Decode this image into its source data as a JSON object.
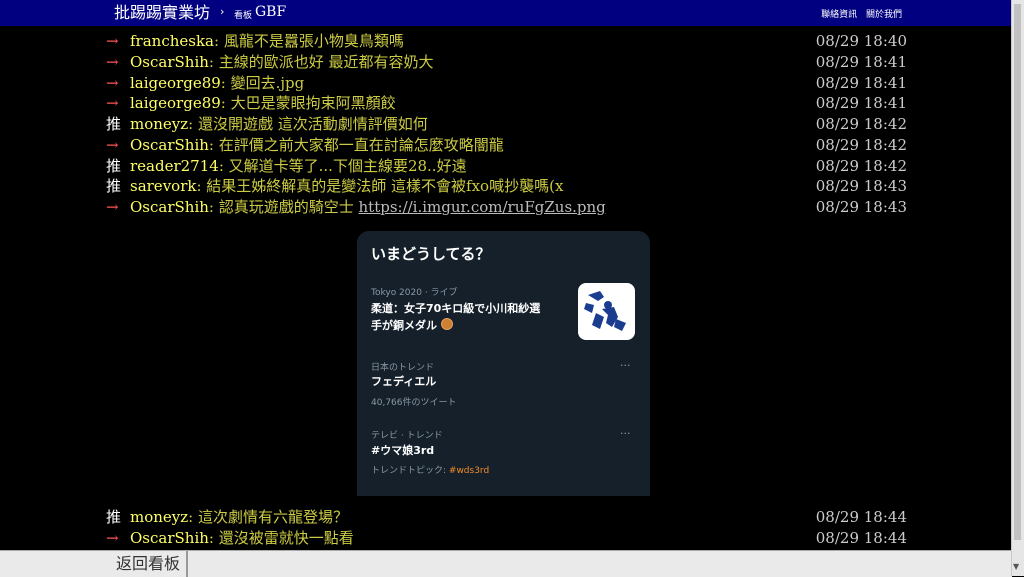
{
  "header": {
    "site_title": "批踢踢實業坊",
    "separator": "›",
    "board_label": "看板",
    "board_name": "GBF",
    "links": [
      "聯絡資訊",
      "關於我們"
    ]
  },
  "pushes_top": [
    {
      "tag": "→",
      "user": "francheska",
      "content": ": 風龍不是囂張小物臭鳥類嗎",
      "time": "08/29 18:40"
    },
    {
      "tag": "→",
      "user": "OscarShih",
      "content": ": 主線的歐派也好 最近都有容奶大",
      "time": "08/29 18:41"
    },
    {
      "tag": "→",
      "user": "laigeorge89",
      "content": ": 變回去.jpg",
      "time": "08/29 18:41"
    },
    {
      "tag": "→",
      "user": "laigeorge89",
      "content": ": 大巴是蒙眼拘束阿黑顏餃",
      "time": "08/29 18:41"
    },
    {
      "tag": "推",
      "user": "moneyz",
      "content": ": 還沒開遊戲 這次活動劇情評價如何",
      "time": "08/29 18:42"
    },
    {
      "tag": "→",
      "user": "OscarShih",
      "content": ": 在評價之前大家都一直在討論怎麼攻略闇龍",
      "time": "08/29 18:42"
    },
    {
      "tag": "推",
      "user": "reader2714",
      "content": ": 又解道卡等了...下個主線要28..好遠",
      "time": "08/29 18:42"
    },
    {
      "tag": "推",
      "user": "sarevork",
      "content": ": 結果王姊終解真的是變法師 這樣不會被fxo喊抄襲嗎(x",
      "time": "08/29 18:43"
    },
    {
      "tag": "→",
      "user": "OscarShih",
      "content": ": 認真玩遊戲的騎空士 ",
      "link": "https://i.imgur.com/ruFgZus.png",
      "time": "08/29 18:43"
    }
  ],
  "pushes_bottom": [
    {
      "tag": "推",
      "user": "moneyz",
      "content": ": 這次劇情有六龍登場？",
      "time": "08/29 18:44"
    },
    {
      "tag": "→",
      "user": "OscarShih",
      "content": ": 還沒被雷就快一點看",
      "time": "08/29 18:44"
    }
  ],
  "twitter_card": {
    "heading": "いまどうしてる？",
    "item1_meta": "Tokyo 2020 · ライブ",
    "item1_title_line1": "柔道：女子70キロ級で小川和紗選",
    "item1_title_line2": "手が銅メダル",
    "item2_meta": "日本のトレンド",
    "item2_title": "フェディエル",
    "item2_sub": "40,766件のツイート",
    "item3_meta": "テレビ · トレンド",
    "item3_title": "#ウマ娘3rd",
    "item3_sub_prefix": "トレンドトピック: ",
    "item3_sub_tag": "#wds3rd",
    "more": "···"
  },
  "footer": {
    "back_label": "返回看板"
  },
  "colors": {
    "header_bg": "#000080",
    "arrow_tag": "#ff5555",
    "user": "#ffff66",
    "content": "#cccc44",
    "card_bg": "#15202b",
    "hashtag": "#f28c28"
  }
}
